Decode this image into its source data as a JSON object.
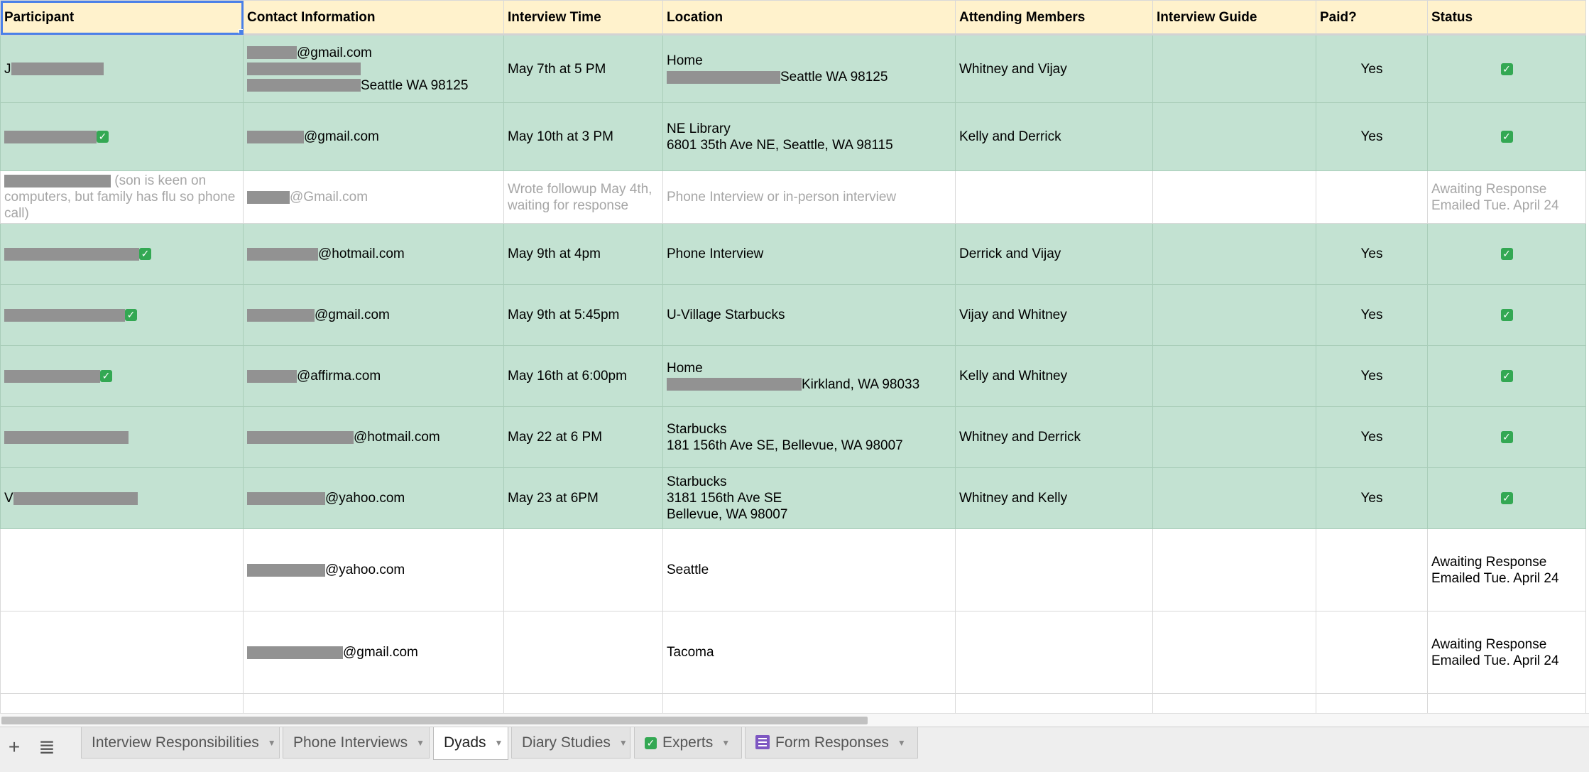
{
  "headers": [
    "Participant",
    "Contact Information",
    "Interview Time",
    "Location",
    "Attending Members",
    "Interview Guide",
    "Paid?",
    "Status"
  ],
  "rows": [
    {
      "style": "green",
      "participant_prefix": "J",
      "contact_lines": [
        "@gmail.com",
        "",
        "Seattle WA 98125"
      ],
      "time": "May 7th at 5 PM",
      "location_lines": [
        "Home",
        "Seattle WA 98125"
      ],
      "members": "Whitney and Vijay",
      "guide": "",
      "paid": "Yes",
      "status": "check"
    },
    {
      "style": "green",
      "participant_prefix": "",
      "contact_lines": [
        "@gmail.com"
      ],
      "time": "May 10th at 3 PM",
      "location_lines": [
        "NE Library",
        "6801 35th Ave NE, Seattle, WA 98115"
      ],
      "members": "Kelly and Derrick",
      "guide": "",
      "paid": "Yes",
      "status": "check"
    },
    {
      "style": "white gray",
      "participant_prefix": "",
      "participant_text": "(son is keen on computers, but family has flu so phone call)",
      "contact_lines": [
        "@Gmail.com"
      ],
      "time": "Wrote followup May 4th, waiting for response",
      "location_lines": [
        "Phone Interview or in-person interview"
      ],
      "members": "",
      "guide": "",
      "paid": "",
      "status_lines": [
        "Awaiting Response",
        "Emailed Tue. April 24"
      ]
    },
    {
      "style": "green",
      "participant_prefix": "",
      "contact_lines": [
        "@hotmail.com"
      ],
      "time": "May 9th at 4pm",
      "location_lines": [
        "Phone Interview"
      ],
      "members": "Derrick and Vijay",
      "guide": "",
      "paid": "Yes",
      "status": "check"
    },
    {
      "style": "green",
      "participant_prefix": "",
      "contact_lines": [
        "@gmail.com"
      ],
      "time": "May 9th at 5:45pm",
      "location_lines": [
        "U-Village Starbucks"
      ],
      "members": "Vijay and Whitney",
      "guide": "",
      "paid": "Yes",
      "status": "check"
    },
    {
      "style": "green",
      "participant_prefix": "",
      "contact_lines": [
        "@affirma.com"
      ],
      "time": "May 16th at 6:00pm",
      "location_lines": [
        "Home",
        "Kirkland, WA 98033"
      ],
      "members": "Kelly and Whitney",
      "guide": "",
      "paid": "Yes",
      "status": "check"
    },
    {
      "style": "green",
      "participant_prefix": "",
      "contact_lines": [
        "@hotmail.com"
      ],
      "time": "May 22 at 6 PM",
      "location_lines": [
        "Starbucks",
        "181 156th Ave SE, Bellevue, WA 98007"
      ],
      "members": "Whitney and Derrick",
      "guide": "",
      "paid": "Yes",
      "status": "check"
    },
    {
      "style": "green",
      "participant_prefix": "V",
      "contact_lines": [
        "@yahoo.com"
      ],
      "time": "May 23 at 6PM",
      "location_lines": [
        "Starbucks",
        "3181 156th Ave SE",
        "Bellevue, WA 98007"
      ],
      "members": "Whitney and Kelly",
      "guide": "",
      "paid": "Yes",
      "status": "check"
    },
    {
      "style": "white",
      "participant_prefix": "",
      "contact_lines": [
        "@yahoo.com"
      ],
      "time": "",
      "location_lines": [
        "Seattle"
      ],
      "members": "",
      "guide": "",
      "paid": "",
      "status_lines": [
        "Awaiting Response",
        "Emailed Tue. April 24"
      ]
    },
    {
      "style": "white",
      "participant_prefix": "",
      "contact_lines": [
        "@gmail.com"
      ],
      "time": "",
      "location_lines": [
        "Tacoma"
      ],
      "members": "",
      "guide": "",
      "paid": "",
      "status_lines": [
        "Awaiting Response",
        "Emailed Tue. April 24"
      ]
    }
  ],
  "tabs": [
    {
      "label": "Interview Responsibilities",
      "active": false,
      "icon": ""
    },
    {
      "label": "Phone Interviews",
      "active": false,
      "icon": ""
    },
    {
      "label": "Dyads",
      "active": true,
      "icon": ""
    },
    {
      "label": "Diary Studies",
      "active": false,
      "icon": ""
    },
    {
      "label": "Experts",
      "active": false,
      "icon": "check-icon"
    },
    {
      "label": "Form Responses",
      "active": false,
      "icon": "form-icon"
    }
  ],
  "toolbar": {
    "add_sheet_icon": "+",
    "all_sheets_icon": "≣"
  }
}
